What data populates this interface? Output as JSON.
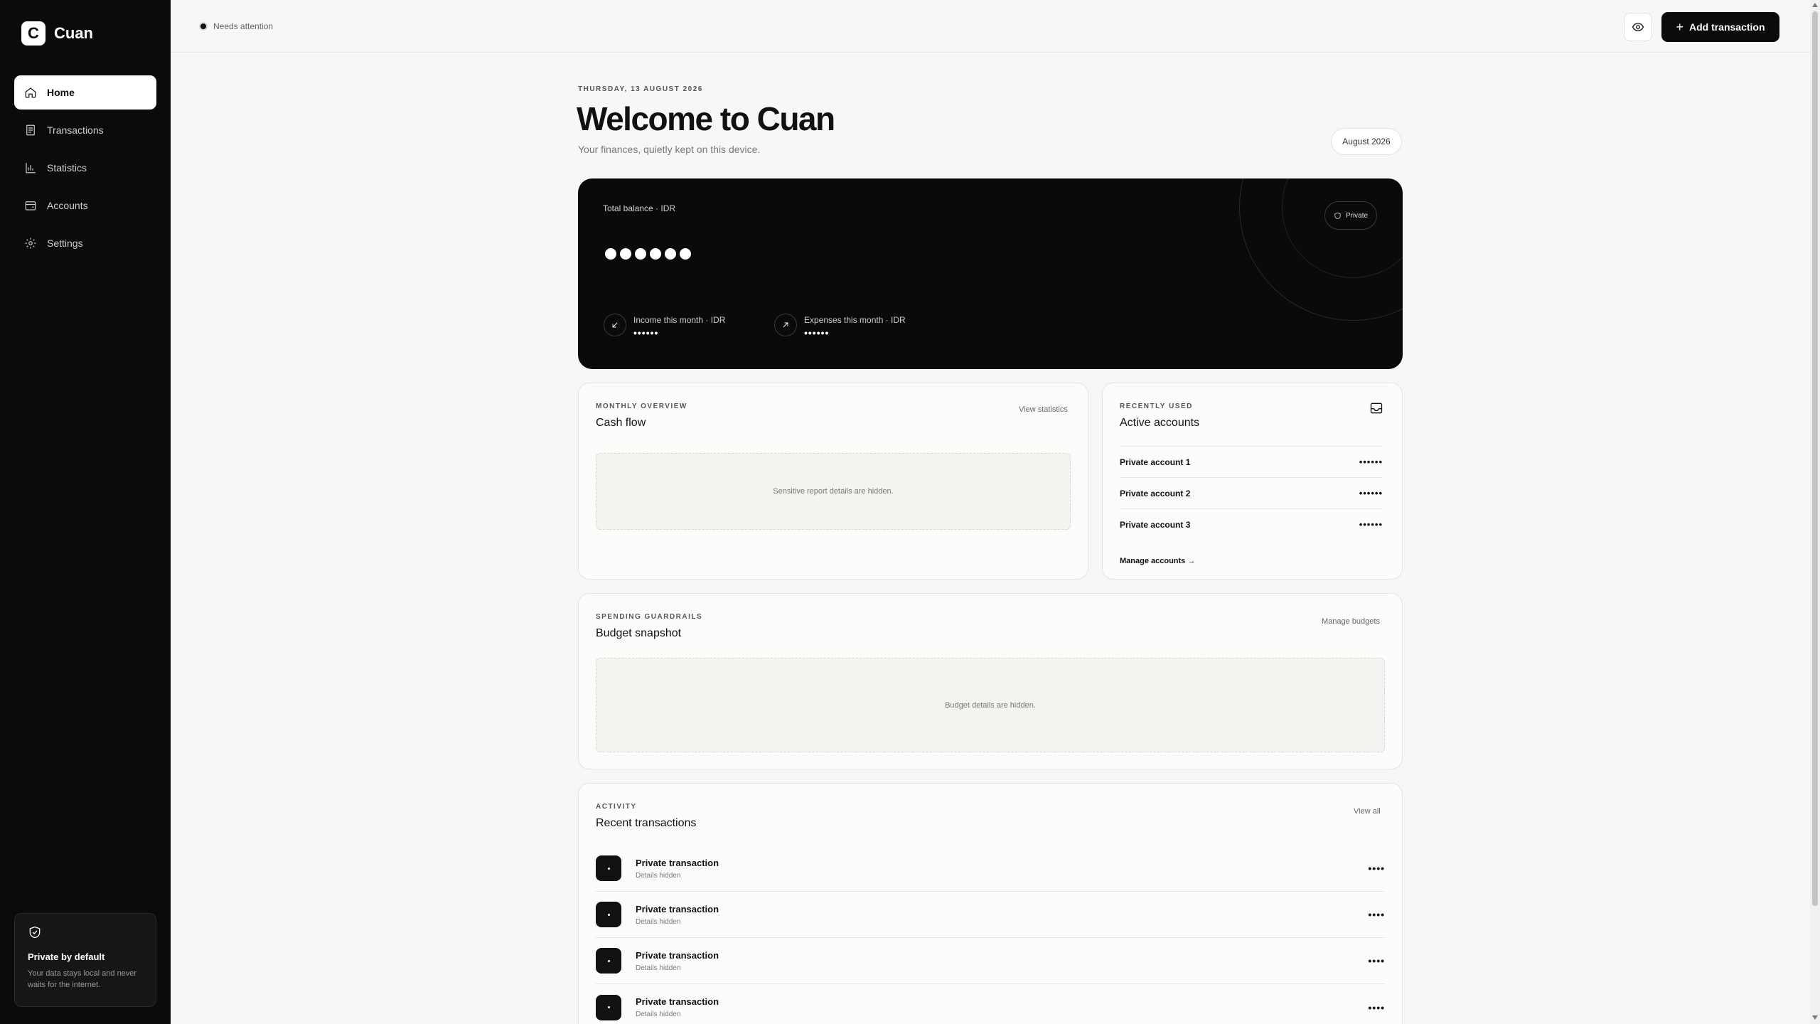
{
  "app": {
    "name": "Cuan",
    "logo_letter": "C"
  },
  "sidebar": {
    "items": [
      {
        "label": "Home",
        "icon": "home-icon",
        "active": true
      },
      {
        "label": "Transactions",
        "icon": "receipt-icon"
      },
      {
        "label": "Statistics",
        "icon": "bar-chart-icon"
      },
      {
        "label": "Accounts",
        "icon": "wallet-icon"
      },
      {
        "label": "Settings",
        "icon": "gear-icon"
      }
    ],
    "privacy": {
      "title": "Private by default",
      "text": "Your data stays local and never waits for the internet."
    }
  },
  "topbar": {
    "status": "Needs attention",
    "add_label": "Add transaction"
  },
  "header": {
    "date": "THURSDAY, 13 AUGUST 2026",
    "title": "Welcome to Cuan",
    "subtitle": "Your finances, quietly kept on this device.",
    "month": "August 2026"
  },
  "balance": {
    "label": "Total balance · IDR",
    "private_label": "Private",
    "income_label": "Income this month · IDR",
    "income_value": "••••••",
    "expense_label": "Expenses this month · IDR",
    "expense_value": "••••••"
  },
  "cashflow": {
    "eyebrow": "MONTHLY OVERVIEW",
    "title": "Cash flow",
    "link": "View statistics",
    "hidden": "Sensitive report details are hidden."
  },
  "accounts": {
    "eyebrow": "RECENTLY USED",
    "title": "Active accounts",
    "items": [
      {
        "name": "Private account 1",
        "value": "••••••"
      },
      {
        "name": "Private account 2",
        "value": "••••••"
      },
      {
        "name": "Private account 3",
        "value": "••••••"
      }
    ],
    "manage": "Manage accounts →"
  },
  "budget": {
    "eyebrow": "SPENDING GUARDRAILS",
    "title": "Budget snapshot",
    "link": "Manage budgets",
    "hidden": "Budget details are hidden."
  },
  "activity": {
    "eyebrow": "ACTIVITY",
    "title": "Recent transactions",
    "link": "View all",
    "items": [
      {
        "name": "Private transaction",
        "sub": "Details hidden",
        "amount": "••••"
      },
      {
        "name": "Private transaction",
        "sub": "Details hidden",
        "amount": "••••"
      },
      {
        "name": "Private transaction",
        "sub": "Details hidden",
        "amount": "••••"
      },
      {
        "name": "Private transaction",
        "sub": "Details hidden",
        "amount": "••••"
      }
    ]
  },
  "colors": {
    "sidebar_bg": "#0b0b0b",
    "page_bg": "#f7f7f5",
    "accent": "#111111"
  }
}
